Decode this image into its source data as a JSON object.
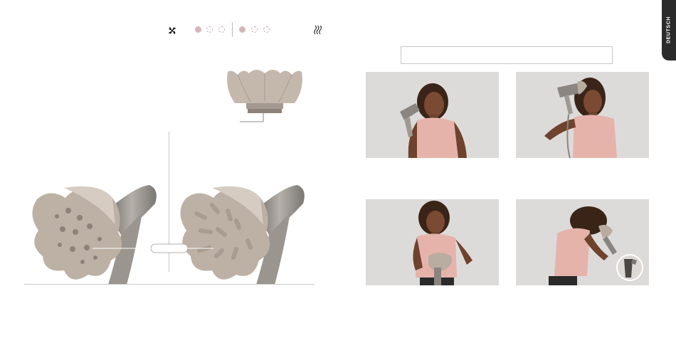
{
  "language_tab": {
    "label": "DEUTSCH"
  },
  "icons": {
    "airflow": "fan-icon",
    "heat": "heat-waves-icon"
  },
  "settings_indicator": {
    "group_left": {
      "filled": 1,
      "total": 3
    },
    "group_right": {
      "filled": 1,
      "total": 3
    }
  },
  "colors": {
    "dot": "#d4b5b9",
    "tab": "#2b2b2b",
    "attachment": "#b8aba1",
    "body": "#8d8985",
    "shirt": "#e6b3ab"
  }
}
